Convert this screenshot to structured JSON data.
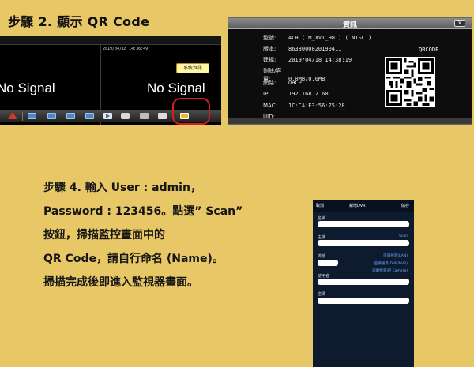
{
  "step2_title": "步驟 2. 顯示 QR Code",
  "dvr": {
    "timestamp": "2019/04/18 14:36:49",
    "left_channel": "No Signal",
    "right_channel": "No Signal",
    "tooltip": "系統資訊",
    "toolbar_icons": [
      "home-icon",
      "screen-icon",
      "screen-icon",
      "screen-icon",
      "screen-icon",
      "screen-icon",
      "play-icon",
      "camera-icon",
      "video-icon",
      "cloud-icon",
      "info-icon"
    ]
  },
  "dialog": {
    "title": "資訊",
    "close": "×",
    "rows": [
      {
        "label": "型號:",
        "value": "4CH ( M_XVI_H8 ) ( NTSC )"
      },
      {
        "label": "版本:",
        "value": "8638000020190411"
      },
      {
        "label": "建檔:",
        "value": "2019/04/18 14:38:19"
      },
      {
        "label": "剩餘/容量:",
        "value": "0.0MB/0.0MB"
      },
      {
        "label": "網路:",
        "value": "DHCP"
      },
      {
        "label": "IP:",
        "value": "192.168.2.60"
      },
      {
        "label": "MAC:",
        "value": "1C:CA:E3:56:75:28"
      },
      {
        "label": "UID:",
        "value": ""
      }
    ],
    "qr_label": "QRCODE"
  },
  "step4": {
    "lines": [
      "步驟 4. 輸入 User : admin，",
      "Password : 123456。點選” Scan”",
      "按鈕，掃描監控畫面中的",
      "QR Code，請自行命名 (Name)。",
      "掃描完成後即進入監視器畫面。"
    ]
  },
  "phone": {
    "nav_left": "取消",
    "nav_title": "新增DVR",
    "nav_right": "儲存",
    "name_label": "名稱",
    "host_label": "主機",
    "scan_link": "Scan",
    "port_label": "埠號",
    "search_lan": "區域搜尋(LAN)",
    "search_dvr": "區網搜尋(DVR/NVR)",
    "search_camera": "區網搜尋(IP Camera)",
    "user_label": "使用者",
    "password_label": "密碼"
  },
  "colors": {
    "background": "#e8c766",
    "highlight": "#d21f1f",
    "dialog": "#0d0d0d",
    "phone": "#0e1b2e"
  }
}
